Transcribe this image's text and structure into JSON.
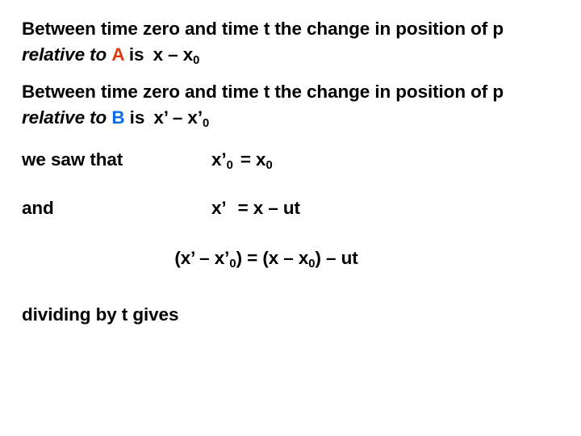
{
  "slide": {
    "background_color": "#ffffff",
    "text_color": "#000000",
    "accent_color_a": "#e03a11",
    "accent_color_b": "#0b6be8"
  },
  "paragraph_a": {
    "lead": "Between time zero and time t the change in position of p ",
    "emphasis": "relative to",
    "frame": "A",
    "connector": " is ",
    "expression_base": "x – x",
    "expression_sub": "0"
  },
  "paragraph_b": {
    "lead": "Between time zero and time t the change in position of p ",
    "emphasis": "relative to",
    "frame": "B",
    "connector": " is ",
    "expression_base": "x’ – x’",
    "expression_sub": "0"
  },
  "row_saw": {
    "label": "we saw that",
    "eq_left_base": "x’",
    "eq_left_sub": "0",
    "eq_operator": "= x",
    "eq_right_sub": "0"
  },
  "row_and": {
    "label": "and",
    "eq_left": "x’",
    "eq_rest": "= x – ut"
  },
  "equation_center": {
    "open_left": "(x’ – x’",
    "sub_left": "0",
    "mid": ") = (x – x",
    "sub_right": "0",
    "tail": ") – ut"
  },
  "closing": {
    "text": "dividing by t gives"
  }
}
